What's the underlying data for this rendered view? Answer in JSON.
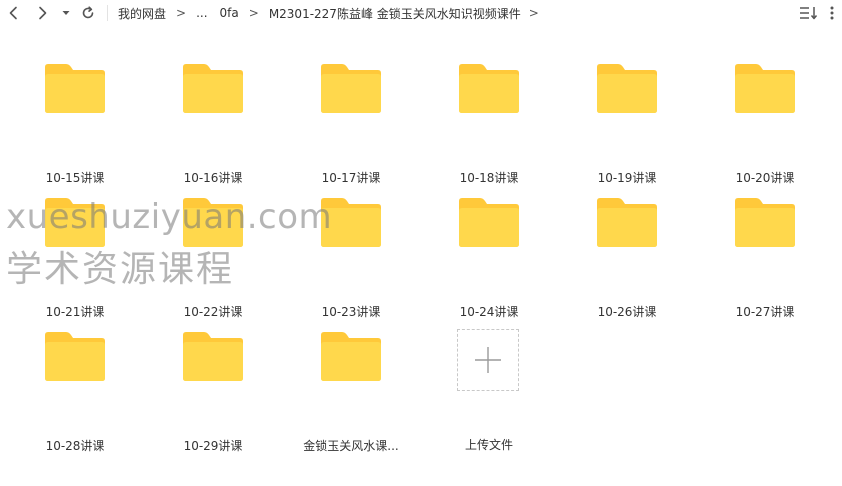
{
  "breadcrumb": {
    "root": "我的网盘",
    "ellipsis": "...",
    "segment": "0fa",
    "current": "M2301-227陈益峰 金锁玉关风水知识视频课件",
    "separator": ">"
  },
  "folders": [
    {
      "name": "10-15讲课"
    },
    {
      "name": "10-16讲课"
    },
    {
      "name": "10-17讲课"
    },
    {
      "name": "10-18讲课"
    },
    {
      "name": "10-19讲课"
    },
    {
      "name": "10-20讲课"
    },
    {
      "name": "10-21讲课"
    },
    {
      "name": "10-22讲课"
    },
    {
      "name": "10-23讲课"
    },
    {
      "name": "10-24讲课"
    },
    {
      "name": "10-26讲课"
    },
    {
      "name": "10-27讲课"
    },
    {
      "name": "10-28讲课"
    },
    {
      "name": "10-29讲课"
    },
    {
      "name": "金锁玉关风水课..."
    }
  ],
  "upload": {
    "label": "上传文件"
  },
  "watermark": {
    "line1": "xueshuziyuan.com",
    "line2": "学术资源课程"
  },
  "colors": {
    "folder_body": "#FFD84C",
    "folder_tab": "#FFC93A",
    "icon_gray": "#555555"
  }
}
